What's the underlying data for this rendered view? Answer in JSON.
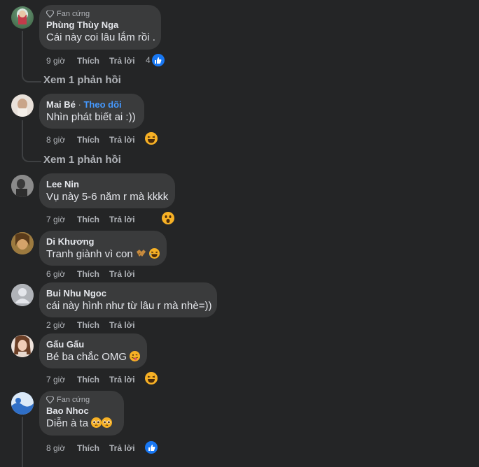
{
  "comments": [
    {
      "badge": "Fan cứng",
      "name": "Phùng Thùy Nga",
      "text": "Cái này coi lâu lắm rồi .",
      "time": "9 giờ",
      "like": "Thích",
      "reply": "Trả lời",
      "reaction_count": "4",
      "reaction_icon": "like-icon",
      "view_replies": "Xem 1 phản hồi"
    },
    {
      "name": "Mai Bé",
      "dot": " · ",
      "follow": "Theo dõi",
      "text": "Nhìn phát biết ai :))",
      "time": "8 giờ",
      "like": "Thích",
      "reply": "Trả lời",
      "reaction_icon": "haha-emoji-icon",
      "view_replies": "Xem 1 phản hồi"
    },
    {
      "name": "Lee Nin",
      "text": "Vụ này 5-6 năm r mà kkkk",
      "time": "7 giờ",
      "like": "Thích",
      "reply": "Trả lời",
      "reaction_icon": "wow-emoji-icon"
    },
    {
      "name": "Di Khương",
      "text": "Tranh giành vì con",
      "time": "6 giờ",
      "like": "Thích",
      "reply": "Trả lời",
      "text_icons": [
        "handshake-emoji-icon",
        "laughing-emoji-icon"
      ]
    },
    {
      "name": "Bui Nhu Ngoc",
      "text": "cái này hình như từ lâu r mà nhè=))",
      "time": "2 giờ",
      "like": "Thích",
      "reply": "Trả lời"
    },
    {
      "name": "Gấu Gấu",
      "text": "Bé ba chắc OMG",
      "time": "7 giờ",
      "like": "Thích",
      "reply": "Trả lời",
      "text_icons": [
        "tongue-emoji-icon"
      ],
      "reaction_icon": "haha-emoji-icon"
    },
    {
      "badge": "Fan cứng",
      "name": "Bao Nhoc",
      "text": "Diễn à ta",
      "time": "8 giờ",
      "like": "Thích",
      "reply": "Trả lời",
      "text_icons": [
        "pleading-emoji-icon",
        "pleading-emoji-icon"
      ],
      "reaction_icon": "like-icon"
    }
  ],
  "colors": {
    "background": "#242526",
    "bubble": "#3a3b3c",
    "accent": "#1877f2",
    "link": "#4599ff",
    "secondary": "#b0b3b8"
  }
}
